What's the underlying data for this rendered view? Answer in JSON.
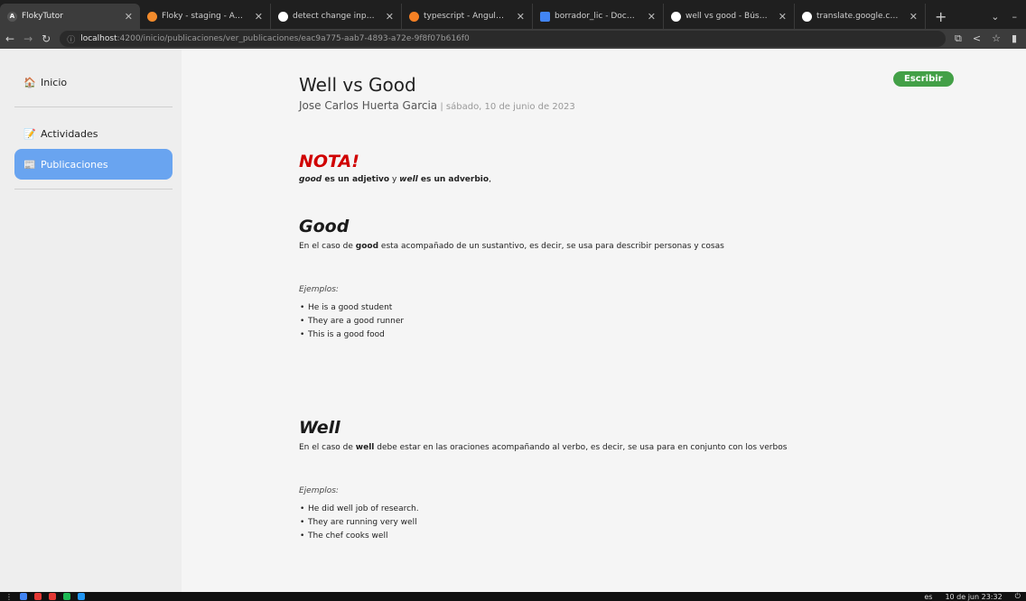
{
  "browser": {
    "tabs": [
      {
        "title": "FlokyTutor",
        "fav": "A",
        "color": "#3a3a3a",
        "active": true
      },
      {
        "title": "Floky - staging - Amplify Studio",
        "fav": "",
        "color": "#f28b2c",
        "active": false
      },
      {
        "title": "detect change input text angula",
        "fav": "",
        "color": "#ffffff",
        "active": false
      },
      {
        "title": "typescript - Angular on keyup.e",
        "fav": "",
        "color": "#f48024",
        "active": false
      },
      {
        "title": "borrador_lic - Documentos de G",
        "fav": "",
        "color": "#4285f4",
        "active": false
      },
      {
        "title": "well vs good - Búsqueda de Goo",
        "fav": "",
        "color": "#ffffff",
        "active": false
      },
      {
        "title": "translate.google.com - Buscar c",
        "fav": "",
        "color": "#ffffff",
        "active": false
      }
    ],
    "new_tab": "+",
    "url_host": "localhost",
    "url_rest": ":4200/inicio/publicaciones/ver_publicaciones/eac9a775-aab7-4893-a72e-9f8f07b616f0"
  },
  "sidebar": {
    "items": [
      {
        "label": "Inicio",
        "emoji": "🏠"
      },
      {
        "label": "Actividades",
        "emoji": "📝"
      },
      {
        "label": "Publicaciones",
        "emoji": "📰"
      }
    ]
  },
  "post": {
    "title": "Well vs Good",
    "author": "Jose Carlos Huerta Garcia",
    "separator": " | ",
    "date": "sábado, 10 de junio de 2023",
    "write_button": "Escribir"
  },
  "nota": {
    "heading": "NOTA!",
    "w1": "good",
    "t1": " es un adjetivo",
    "t2": " y ",
    "w2": "well",
    "t3": " es un adverbio",
    "t4": ","
  },
  "good": {
    "heading": "Good",
    "p1": "En el caso de ",
    "word": "good",
    "p2": " esta acompañado de un sustantivo, es decir, se usa para describir personas y cosas",
    "ejemplos": "Ejemplos:",
    "examples": [
      "He is a good student",
      "They are a good runner",
      "This is a good food"
    ]
  },
  "well": {
    "heading": "Well",
    "p1": "En el caso de ",
    "word": "well",
    "p2": " debe estar en las oraciones acompañando al verbo, es decir, se usa para en conjunto con los verbos",
    "ejemplos": "Ejemplos:",
    "examples": [
      "He did well job of research.",
      "They are running very well",
      "The chef cooks well"
    ]
  },
  "taskbar": {
    "lang": "es",
    "clock": "10 de jun 23:32"
  }
}
